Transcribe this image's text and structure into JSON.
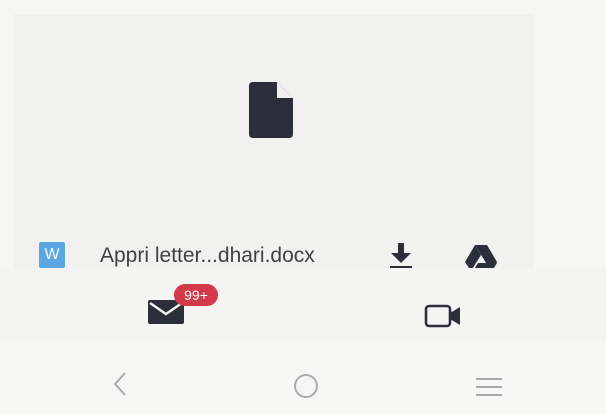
{
  "attachment": {
    "file_type_label": "W",
    "file_name": "Appri letter...dhari.docx",
    "actions": {
      "download_icon": "download-icon",
      "save_to_drive_icon": "google-drive-icon"
    },
    "preview_icon": "document-icon"
  },
  "tab_bar": {
    "mail": {
      "icon": "mail-icon",
      "badge": "99+"
    },
    "meet": {
      "icon": "video-camera-icon"
    }
  },
  "system_nav": {
    "back_icon": "back-chevron-icon",
    "home_icon": "home-circle-icon",
    "recents_icon": "menu-icon"
  },
  "colors": {
    "badge": "#d4394a",
    "word_icon": "#5aa7e4",
    "icon_dark": "#2c2f3a",
    "background": "#f6f7f5"
  }
}
